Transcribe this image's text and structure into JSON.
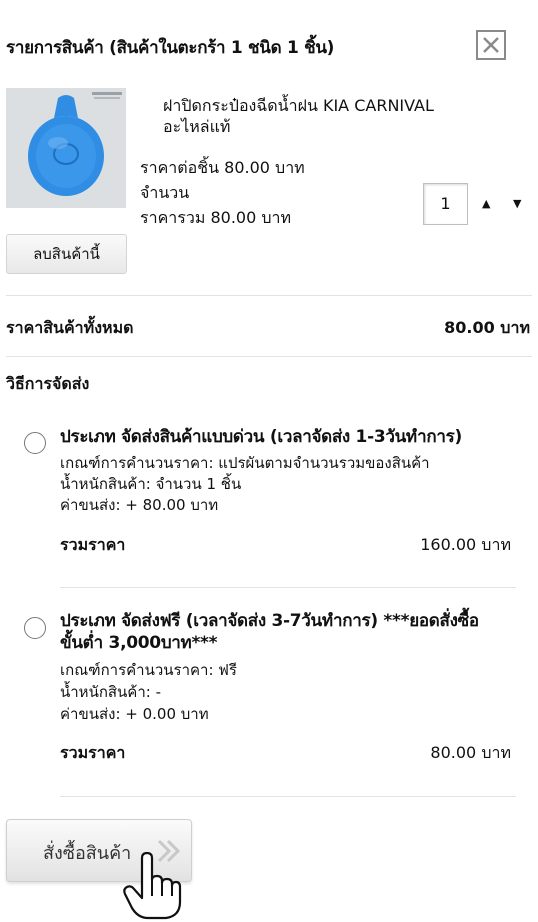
{
  "cart": {
    "title": "รายการสินค้า (สินค้าในตะกร้า 1 ชนิด 1 ชิ้น)",
    "close_icon": "close-x-icon",
    "product": {
      "name_line1": "ฝาปิดกระป๋องฉีดน้ำฝน KIA CARNIVAL",
      "name_line2": "อะไหล่แท้",
      "unit_price": "ราคาต่อชิ้น 80.00 บาท",
      "quantity_label": "จำนวน",
      "line_total": "ราคารวม 80.00 บาท",
      "quantity_value": "1",
      "thumbnail_color": "#2f8de4",
      "remove_label": "ลบสินค้านี้"
    },
    "subtotal": {
      "label": "ราคาสินค้าทั้งหมด",
      "value": "80.00 บาท"
    }
  },
  "shipping": {
    "heading": "วิธีการจัดส่ง",
    "options": [
      {
        "title": "ประเภท จัดส่งสินค้าแบบด่วน (เวลาจัดส่ง 1-3วันทำการ)",
        "title_line2": "",
        "criteria": "เกณฑ์การคำนวนราคา: แปรผันตามจำนวนรวมของสินค้า",
        "weight": "น้ำหนักสินค้า: จำนวน 1 ชิ้น",
        "fee": "ค่าขนส่ง: + 80.00 บาท",
        "sum_label": "รวมราคา",
        "sum_value": "160.00 บาท"
      },
      {
        "title": "ประเภท จัดส่งฟรี (เวลาจัดส่ง 3-7วันทำการ) ***ยอดสั่งซื้อ",
        "title_line2": "ขั้นต่ำ 3,000บาท***",
        "criteria": "เกณฑ์การคำนวนราคา: ฟรี",
        "weight": "น้ำหนักสินค้า: -",
        "fee": "ค่าขนส่ง: + 0.00 บาท",
        "sum_label": "รวมราคา",
        "sum_value": "80.00 บาท"
      }
    ]
  },
  "order_button": {
    "label": "สั่งซื้อสินค้า",
    "icon": "double-chevron-right-icon"
  },
  "colors": {
    "product_blue": "#2f8de4",
    "divider": "#e3e3e3"
  }
}
